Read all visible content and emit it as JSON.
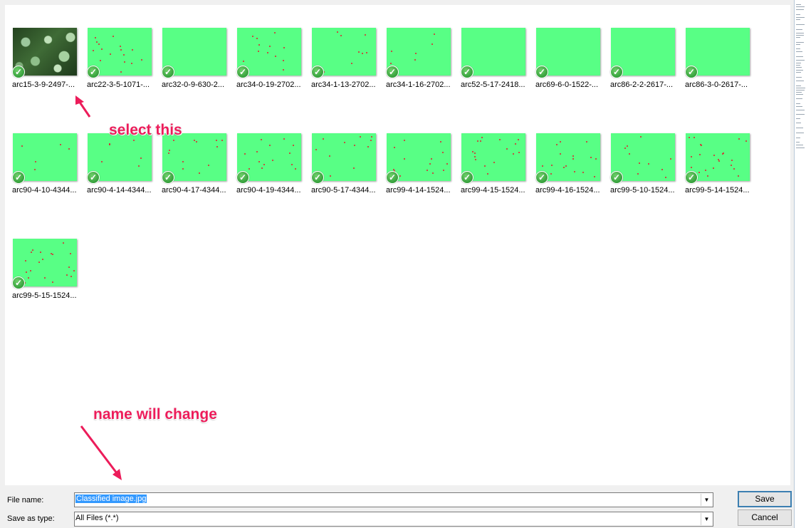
{
  "files": [
    {
      "name": "arc15-3-9-2497-...",
      "thumb": "photo"
    },
    {
      "name": "arc22-3-5-1071-...",
      "thumb": "green"
    },
    {
      "name": "arc32-0-9-630-2...",
      "thumb": "green"
    },
    {
      "name": "arc34-0-19-2702...",
      "thumb": "green"
    },
    {
      "name": "arc34-1-13-2702...",
      "thumb": "green"
    },
    {
      "name": "arc34-1-16-2702...",
      "thumb": "green"
    },
    {
      "name": "arc52-5-17-2418...",
      "thumb": "green"
    },
    {
      "name": "arc69-6-0-1522-...",
      "thumb": "green"
    },
    {
      "name": "arc86-2-2-2617-...",
      "thumb": "green"
    },
    {
      "name": "arc86-3-0-2617-...",
      "thumb": "green"
    },
    {
      "name": "arc90-4-10-4344...",
      "thumb": "green"
    },
    {
      "name": "arc90-4-14-4344...",
      "thumb": "green"
    },
    {
      "name": "arc90-4-17-4344...",
      "thumb": "green"
    },
    {
      "name": "arc90-4-19-4344...",
      "thumb": "green"
    },
    {
      "name": "arc90-5-17-4344...",
      "thumb": "green"
    },
    {
      "name": "arc99-4-14-1524...",
      "thumb": "green"
    },
    {
      "name": "arc99-4-15-1524...",
      "thumb": "green"
    },
    {
      "name": "arc99-4-16-1524...",
      "thumb": "green"
    },
    {
      "name": "arc99-5-10-1524...",
      "thumb": "green"
    },
    {
      "name": "arc99-5-14-1524...",
      "thumb": "green"
    },
    {
      "name": "arc99-5-15-1524...",
      "thumb": "green"
    }
  ],
  "annotations": {
    "select_this": "select this",
    "name_change": "name will change"
  },
  "form": {
    "file_name_label": "File name:",
    "file_name_value": "Classified image.jpg",
    "save_type_label": "Save as type:",
    "save_type_value": "All Files (*.*)",
    "save_button": "Save",
    "cancel_button": "Cancel"
  },
  "icons": {
    "sync_status": "check-circle-icon",
    "dropdown": "chevron-down-icon"
  },
  "colors": {
    "annotation": "#ec1c5a",
    "thumbnail_green": "#58ff85",
    "thumbnail_dot": "#e0202a",
    "selection": "#3399ff"
  }
}
